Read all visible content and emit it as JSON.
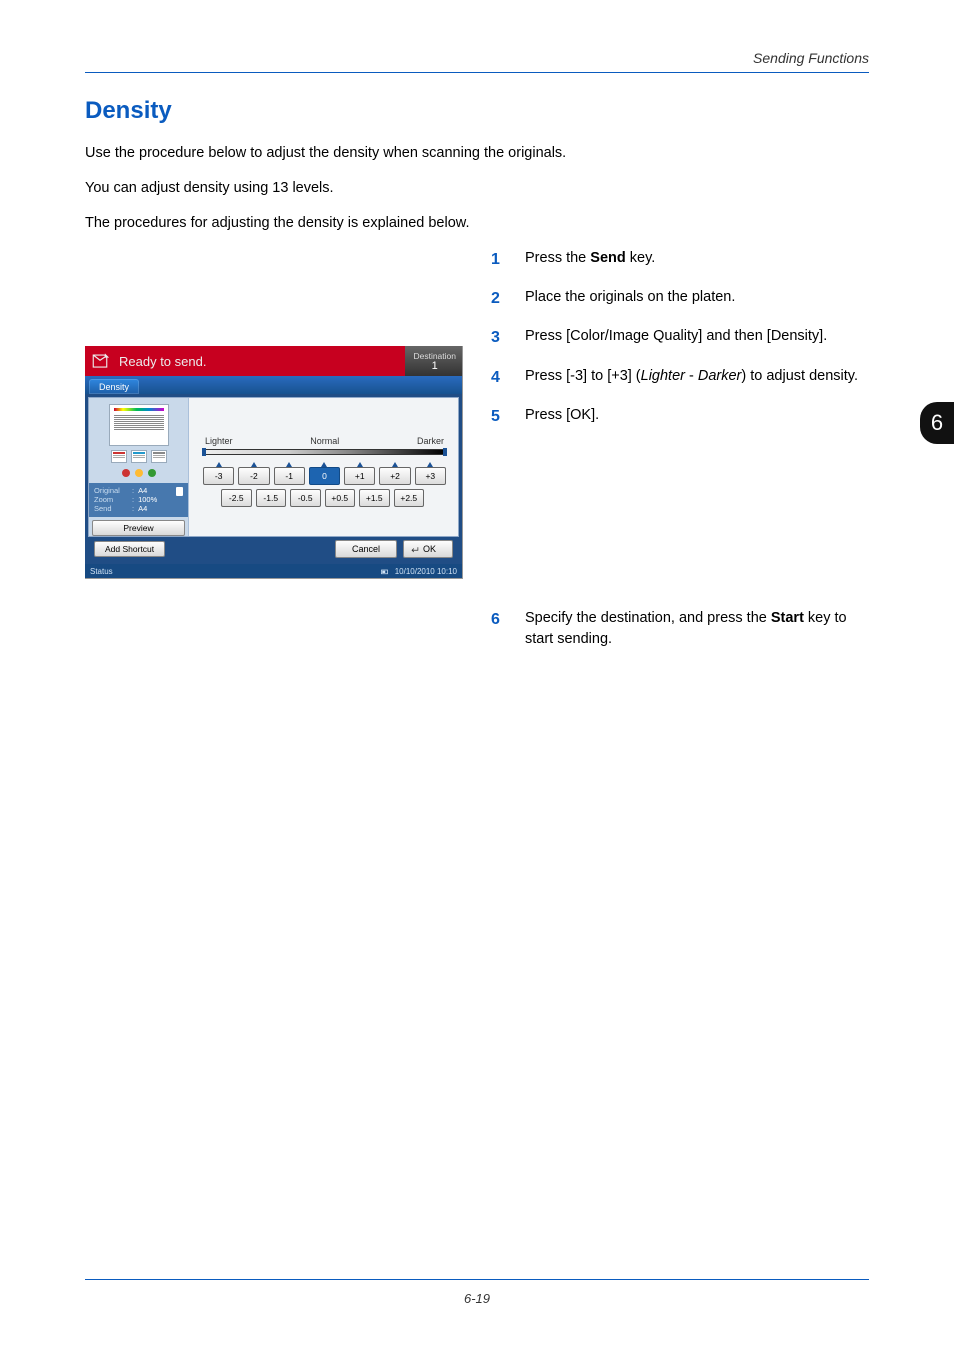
{
  "header": {
    "running": "Sending Functions"
  },
  "section": {
    "title": "Density",
    "p1": "Use the procedure below to adjust the density when scanning the originals.",
    "p2": "You can adjust density using 13 levels.",
    "p3": "The procedures for adjusting the density is explained below."
  },
  "steps": {
    "s1_a": "Press the ",
    "s1_b": "Send",
    "s1_c": " key.",
    "s2": "Place the originals on the platen.",
    "s3": "Press [Color/Image Quality] and then [Density].",
    "s4_a": "Press [-3] to [+3] (",
    "s4_b": "Lighter",
    "s4_c": " - ",
    "s4_d": "Darker",
    "s4_e": ") to adjust density.",
    "s5": "Press [OK].",
    "s6_a": "Specify the destination, and press the ",
    "s6_b": "Start",
    "s6_c": " key to start sending."
  },
  "chapter": {
    "num": "6"
  },
  "page_num": "6-19",
  "shot": {
    "title": "Ready to send.",
    "destination_label": "Destination",
    "destination_value": "1",
    "tab": "Density",
    "info": {
      "original_k": "Original",
      "original_v": "A4",
      "zoom_k": "Zoom",
      "zoom_v": "100%",
      "send_k": "Send",
      "send_v": "A4",
      "colon": ": "
    },
    "preview_btn": "Preview",
    "scale": {
      "lighter": "Lighter",
      "normal": "Normal",
      "darker": "Darker"
    },
    "levels_main": [
      "-3",
      "-2",
      "-1",
      "0",
      "+1",
      "+2",
      "+3"
    ],
    "levels_half": [
      "-2.5",
      "-1.5",
      "-0.5",
      "+0.5",
      "+1.5",
      "+2.5"
    ],
    "footer": {
      "add_shortcut": "Add Shortcut",
      "cancel": "Cancel",
      "ok": "OK"
    },
    "status": {
      "label": "Status",
      "datetime": "10/10/2010  10:10"
    }
  }
}
